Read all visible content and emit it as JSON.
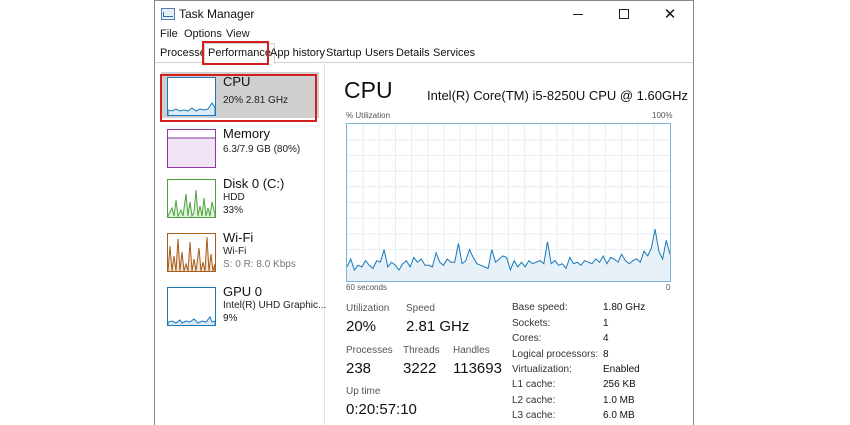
{
  "window": {
    "title": "Task Manager"
  },
  "menu": {
    "file": "File",
    "options": "Options",
    "view": "View"
  },
  "tabs": [
    "Processes",
    "Performance",
    "App history",
    "Startup",
    "Users",
    "Details",
    "Services"
  ],
  "sidebar": {
    "items": [
      {
        "name": "CPU",
        "sub1": "20% 2.81 GHz",
        "color": "#1779ba"
      },
      {
        "name": "Memory",
        "sub1": "6.3/7.9 GB (80%)",
        "color": "#8b3aa3"
      },
      {
        "name": "Disk 0 (C:)",
        "sub1": "HDD",
        "sub2": "33%",
        "color": "#4ca33c"
      },
      {
        "name": "Wi-Fi",
        "sub1": "Wi-Fi",
        "sub2_s": "S: 0",
        "sub2_r": "R: 8.0 Kbps",
        "color": "#a75d1b"
      },
      {
        "name": "GPU 0",
        "sub1": "Intel(R) UHD Graphic...",
        "sub2": "9%",
        "color": "#1779ba"
      }
    ]
  },
  "main": {
    "title": "CPU",
    "model": "Intel(R) Core(TM) i5-8250U CPU @ 1.60GHz",
    "graph": {
      "ylabel": "% Utilization",
      "ymax_label": "100%",
      "xlabel_left": "60 seconds",
      "xlabel_right": "0"
    },
    "stats": {
      "utilization_label": "Utilization",
      "utilization": "20%",
      "speed_label": "Speed",
      "speed": "2.81 GHz",
      "processes_label": "Processes",
      "processes": "238",
      "threads_label": "Threads",
      "threads": "3222",
      "handles_label": "Handles",
      "handles": "113693",
      "uptime_label": "Up time",
      "uptime": "0:20:57:10"
    },
    "specs": [
      {
        "label": "Base speed:",
        "value": "1.80 GHz"
      },
      {
        "label": "Sockets:",
        "value": "1"
      },
      {
        "label": "Cores:",
        "value": "4"
      },
      {
        "label": "Logical processors:",
        "value": "8"
      },
      {
        "label": "Virtualization:",
        "value": "Enabled"
      },
      {
        "label": "L1 cache:",
        "value": "256 KB"
      },
      {
        "label": "L2 cache:",
        "value": "1.0 MB"
      },
      {
        "label": "L3 cache:",
        "value": "6.0 MB"
      }
    ]
  },
  "chart_data": {
    "type": "area",
    "ylabel": "% Utilization",
    "ylim": [
      0,
      100
    ],
    "x_range_seconds": [
      60,
      0
    ],
    "values": [
      9,
      14,
      7,
      10,
      9,
      13,
      10,
      8,
      13,
      12,
      20,
      9,
      12,
      10,
      7,
      11,
      13,
      9,
      15,
      12,
      14,
      10,
      10,
      9,
      18,
      12,
      10,
      14,
      12,
      12,
      24,
      11,
      13,
      20,
      15,
      11,
      10,
      9,
      8,
      20,
      12,
      14,
      16,
      15,
      7,
      13,
      9,
      12,
      9,
      13,
      11,
      12,
      13,
      11,
      25,
      11,
      13,
      10,
      11,
      8,
      15,
      11,
      12,
      10,
      13,
      12,
      11,
      14,
      12,
      16,
      11,
      15,
      14,
      12,
      17,
      13,
      11,
      13,
      14,
      12,
      19,
      16,
      21,
      33,
      19,
      14,
      26,
      17
    ]
  }
}
